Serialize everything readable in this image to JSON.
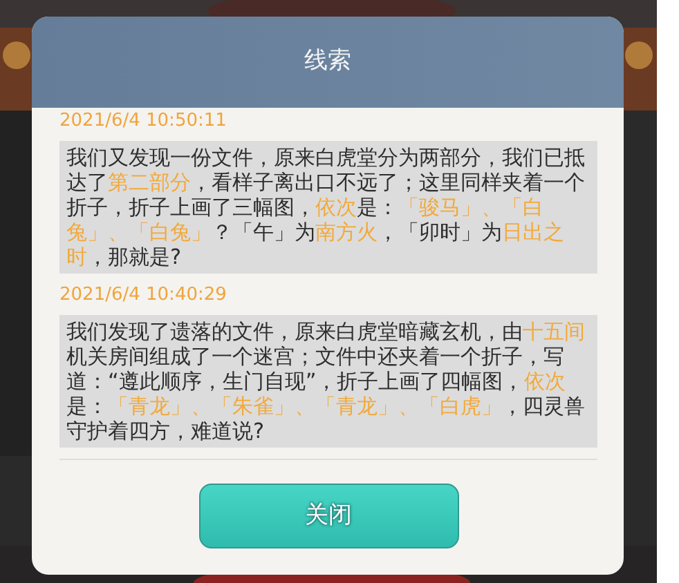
{
  "dialog": {
    "title": "线索",
    "entries": [
      {
        "time": "2021/6/4 10:50:11",
        "segments": [
          {
            "text": "我们又发现一份文件，原来白虎堂分为两部分，我们已抵达了",
            "highlight": false
          },
          {
            "text": "第二部分",
            "highlight": true
          },
          {
            "text": "，看样子离出口不远了；这里同样夹着一个折子，折子上画了三幅图，",
            "highlight": false
          },
          {
            "text": "依次",
            "highlight": true
          },
          {
            "text": "是：",
            "highlight": false
          },
          {
            "text": "「骏马」、「白兔」、「白兔」",
            "highlight": true
          },
          {
            "text": "？「午」为",
            "highlight": false
          },
          {
            "text": "南方火",
            "highlight": true
          },
          {
            "text": "，「卯时」为",
            "highlight": false
          },
          {
            "text": "日出之时",
            "highlight": true
          },
          {
            "text": "，那就是?",
            "highlight": false
          }
        ]
      },
      {
        "time": "2021/6/4 10:40:29",
        "segments": [
          {
            "text": "我们发现了遗落的文件，原来白虎堂暗藏玄机，由",
            "highlight": false
          },
          {
            "text": "十五间",
            "highlight": true
          },
          {
            "text": "机关房间组成了一个迷宫；文件中还夹着一个折子，写道：“遵此顺序，生门自现”，折子上画了四幅图，",
            "highlight": false
          },
          {
            "text": "依次",
            "highlight": true
          },
          {
            "text": "是：",
            "highlight": false
          },
          {
            "text": "「青龙」、「朱雀」、「青龙」、「白虎」",
            "highlight": true
          },
          {
            "text": "，四灵兽守护着四方，难道说?",
            "highlight": false
          }
        ]
      }
    ],
    "button": "关闭"
  }
}
